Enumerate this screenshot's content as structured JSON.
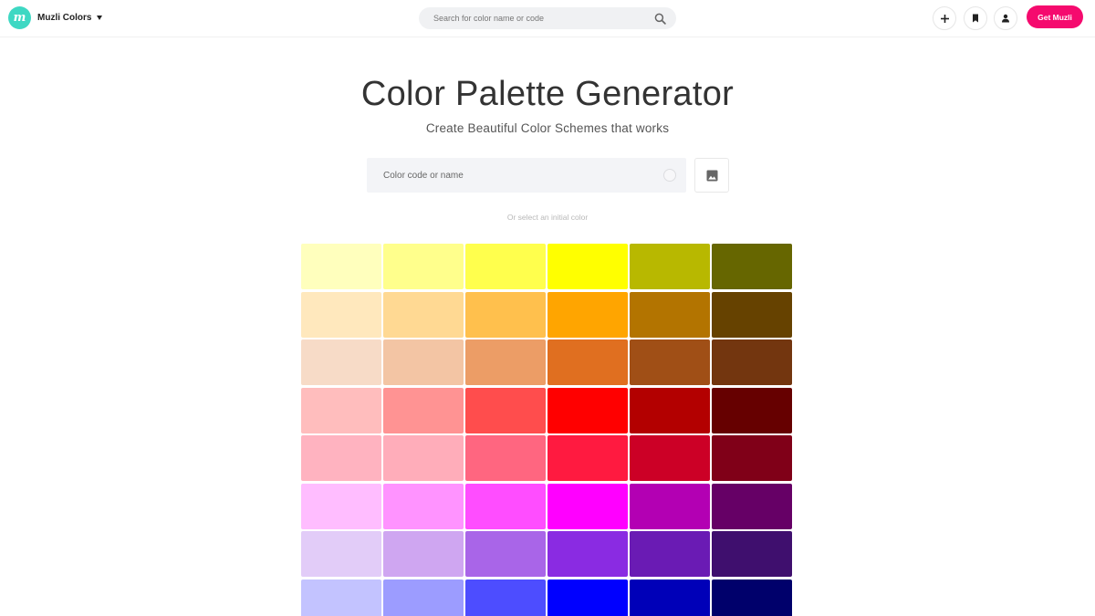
{
  "header": {
    "brand_name": "Muzli Colors",
    "brand_logo_letter": "m",
    "search_placeholder": "Search for color name or code",
    "get_button_label": "Get Muzli",
    "accent_color": "#f50a6e",
    "logo_color": "#3ed8c3",
    "icons": [
      "plus-icon",
      "bookmark-icon",
      "user-icon"
    ]
  },
  "main": {
    "title": "Color Palette Generator",
    "subtitle": "Create Beautiful Color Schemes that works",
    "input_placeholder": "Color code or name",
    "hint": "Or select an initial color"
  },
  "palette": [
    [
      "#ffffbd",
      "#ffff8c",
      "#ffff4d",
      "#ffff00",
      "#b8b800",
      "#666600"
    ],
    [
      "#ffe8bd",
      "#ffd993",
      "#ffc04d",
      "#ffa500",
      "#b37400",
      "#664200"
    ],
    [
      "#f7dbc7",
      "#f3c5a4",
      "#ec9d66",
      "#e06f20",
      "#a04f16",
      "#73360f"
    ],
    [
      "#ffbdbd",
      "#ff9393",
      "#ff4d4d",
      "#ff0000",
      "#b30000",
      "#660000"
    ],
    [
      "#ffb3c0",
      "#ffadba",
      "#ff6680",
      "#ff1a40",
      "#cc0026",
      "#800018"
    ],
    [
      "#ffbdff",
      "#ff93ff",
      "#ff4dff",
      "#ff00ff",
      "#b300b3",
      "#660066"
    ],
    [
      "#e2ccf8",
      "#cfa6f1",
      "#a965e8",
      "#8a2be2",
      "#6a1bb4",
      "#3f0f6e"
    ],
    [
      "#c3c3ff",
      "#9c9cff",
      "#4d4dff",
      "#0000ff",
      "#0000b8",
      "#00006b"
    ]
  ]
}
